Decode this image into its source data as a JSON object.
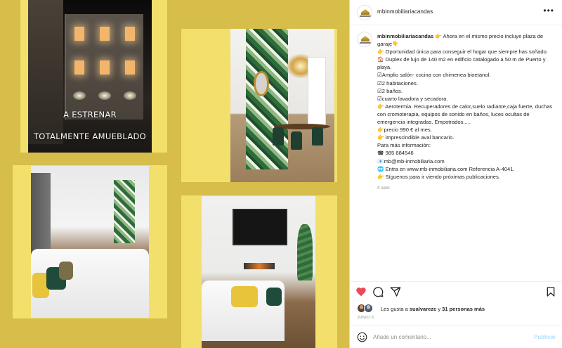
{
  "post": {
    "username": "mbinmobiliariacandas",
    "more_icon": "more-horizontal-icon",
    "photos": [
      {
        "captions": [
          "A ESTRENAR",
          "TOTALMENTE AMUEBLADO"
        ]
      },
      {
        "captions": []
      },
      {
        "captions": []
      },
      {
        "captions": []
      }
    ],
    "caption": {
      "username": "mbinmobiliariacandas",
      "lines": [
        "👉 Ahora en el mismo precio incluye plaza de garaje👇",
        "👉 Oportunidad única para conseguir el hogar que siempre has soñado.",
        "🏠 Duplex de lujo de 140 m2 en edificio catalogado a 50 m de Puerto y playa.",
        "☑Amplio salón- cocina con chimenea bioetanol.",
        "☑2 habitaciones.",
        "☑2 baños.",
        "☑cuarto lavadora y secadora.",
        "👉 Aerotermia. Recuperadores de calor,suelo radiante,caja fuerte, duchas con cromoterapia, equipos de sonido en baños, luces ocultas de emergencia integradas. Empotrados.....",
        "👉precio 990 € al mes.",
        "👉 imprescindible aval bancario.",
        "Para más información:",
        "☎ 985 884546",
        "📧mb@mb-inmobiliaria.com",
        "🌐 Entra en www.mb-inmobiliaria.com Referencia A-4041.",
        "👉 Síguenos para ir viendo próximas publicaciones."
      ],
      "time_ago": "4 sem"
    },
    "actions": {
      "like_icon": "heart-filled-icon",
      "comment_icon": "comment-icon",
      "share_icon": "share-icon",
      "save_icon": "bookmark-icon",
      "like_color": "#ed4956"
    },
    "likes": {
      "prefix": "Les gusta a ",
      "user": "sualvarezc",
      "middle": " y ",
      "others": "31 personas más"
    },
    "date": "JUNIO 5",
    "comment": {
      "emoji_icon": "emoji-icon",
      "placeholder": "Añade un comentario...",
      "post_label": "Publicar"
    }
  }
}
